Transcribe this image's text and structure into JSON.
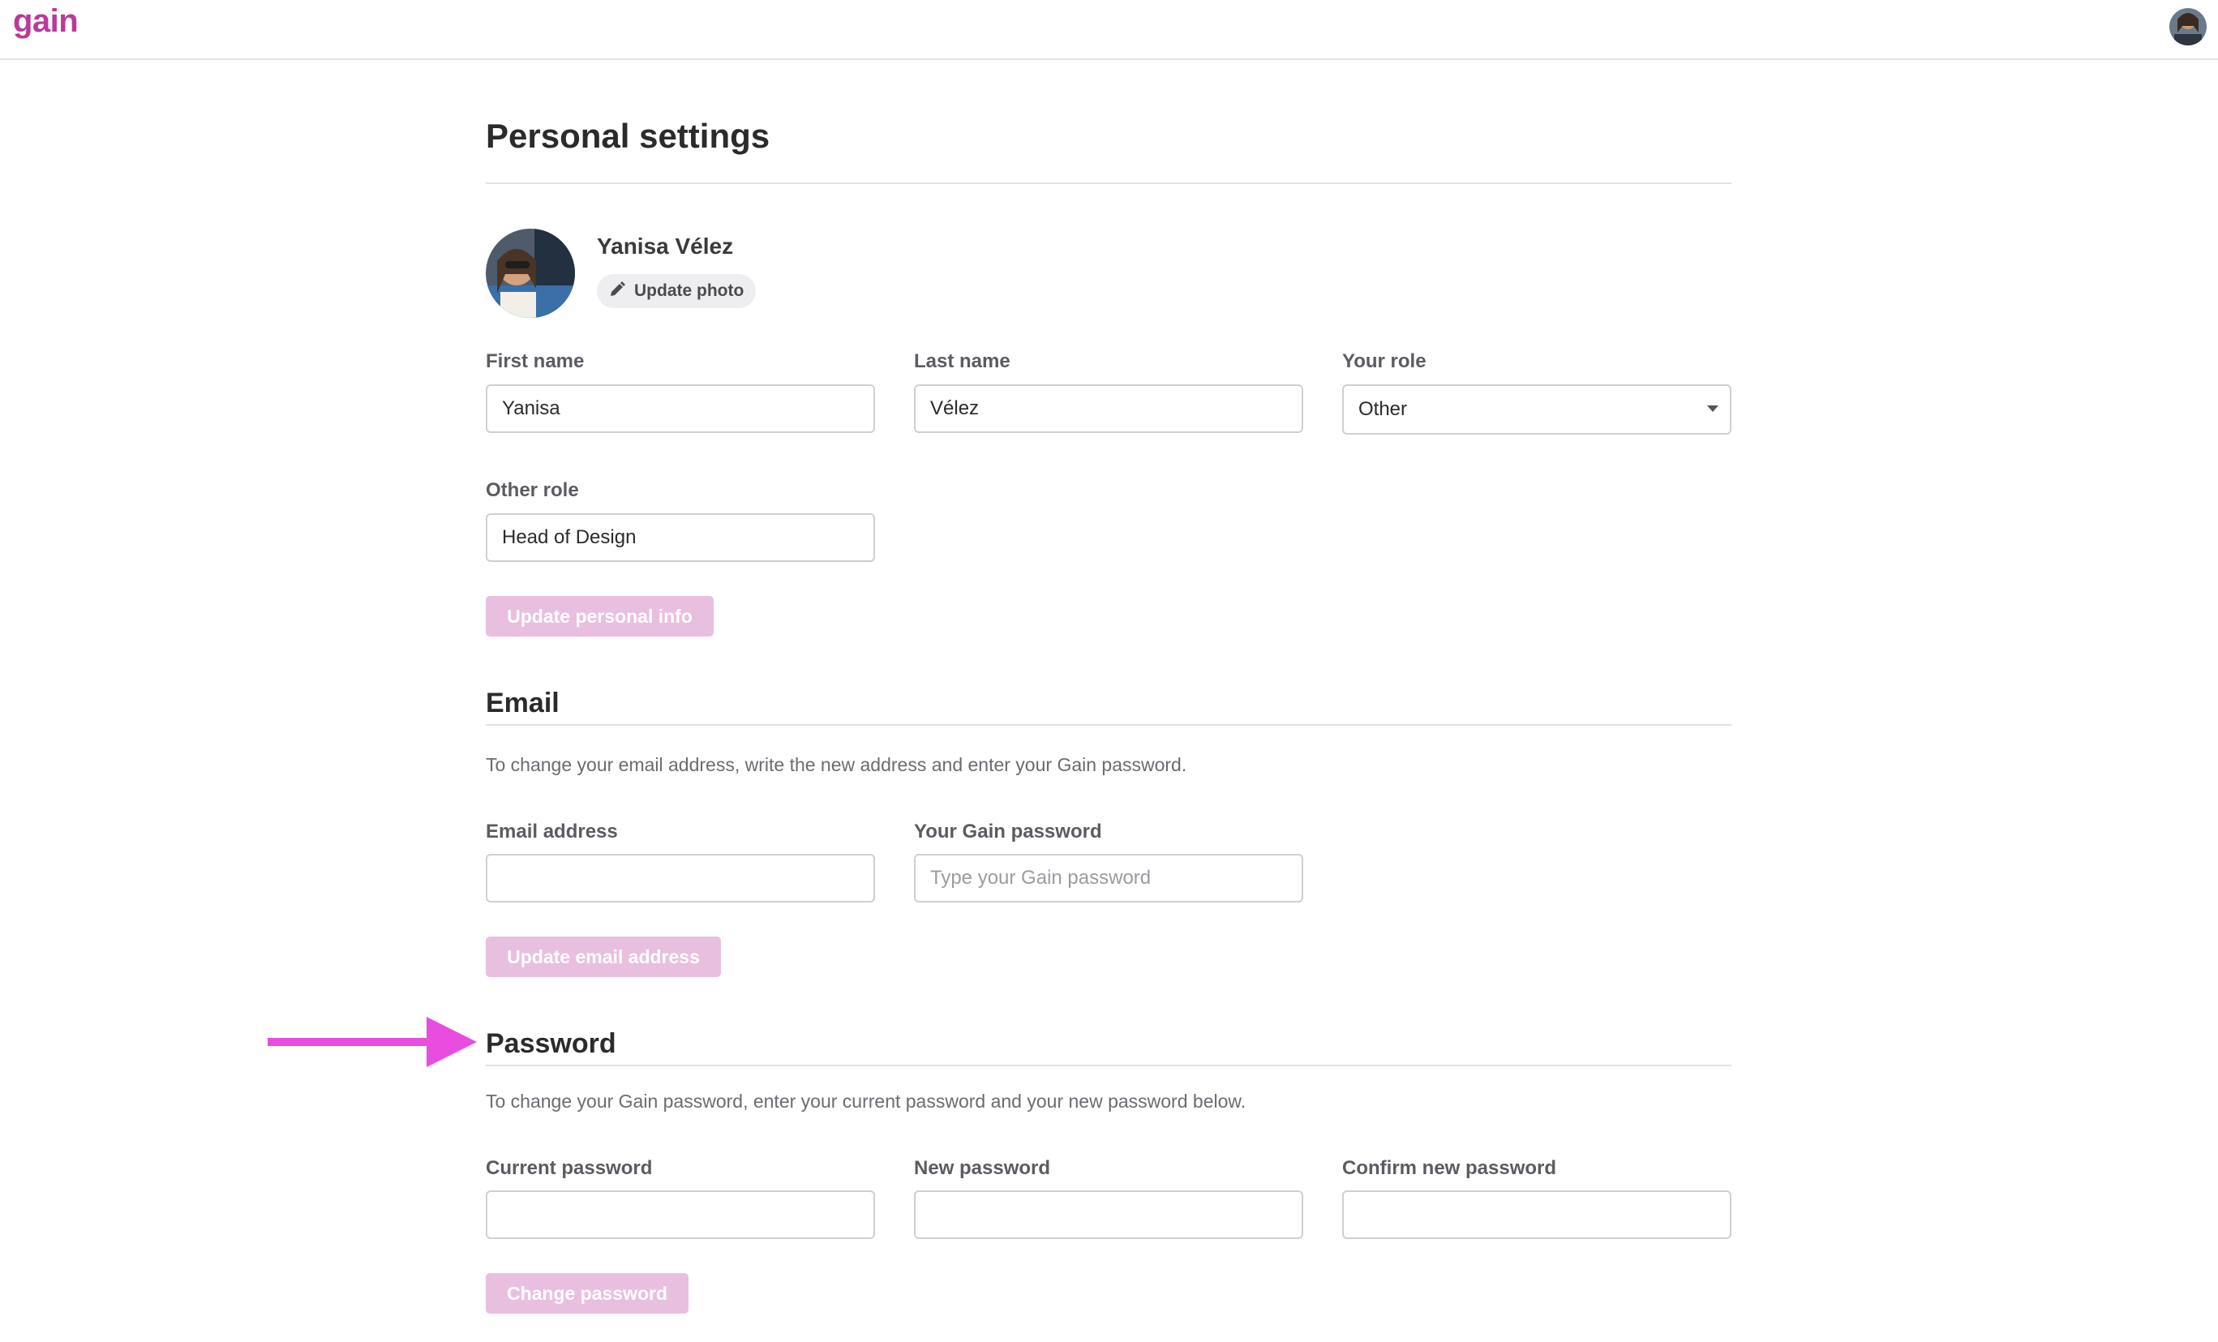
{
  "header": {
    "logo_text": "gain",
    "brand_color": "#b83a9a"
  },
  "page": {
    "title": "Personal settings"
  },
  "profile": {
    "name": "Yanisa Vélez",
    "update_photo_label": "Update photo",
    "update_photo_icon": "pencil-icon"
  },
  "personal": {
    "first_name_label": "First name",
    "first_name_value": "Yanisa",
    "last_name_label": "Last name",
    "last_name_value": "Vélez",
    "role_label": "Your role",
    "role_value": "Other",
    "other_role_label": "Other role",
    "other_role_value": "Head of Design",
    "submit_label": "Update personal info"
  },
  "email": {
    "title": "Email",
    "help": "To change your email address, write the new address and enter your Gain password.",
    "email_label": "Email address",
    "email_value": "",
    "password_label": "Your Gain password",
    "password_placeholder": "Type your Gain password",
    "submit_label": "Update email address"
  },
  "password": {
    "title": "Password",
    "help": "To change your Gain password, enter your current password and your new password below.",
    "current_label": "Current password",
    "new_label": "New password",
    "confirm_label": "Confirm new password",
    "submit_label": "Change password"
  },
  "annotation": {
    "arrow_color": "#e84de0"
  },
  "colors": {
    "disabled_button": "#e9bfe0",
    "input_border": "#cfcfd4"
  }
}
